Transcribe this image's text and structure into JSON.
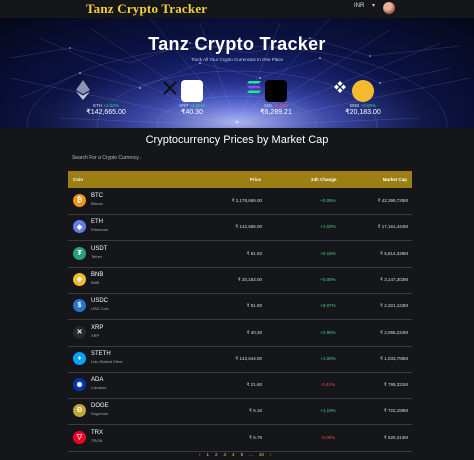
{
  "header": {
    "brand": "Tanz Crypto Tracker",
    "currency": "INR"
  },
  "banner": {
    "title": "Tanz Crypto Tracker",
    "subtitle": "Track All Your Crypto Currencies In One Place",
    "coins": [
      {
        "symbol": "ETH",
        "change": "+1.02%",
        "price": "₹142,665.00",
        "icon": "ethereum-icon"
      },
      {
        "symbol": "XRP",
        "change": "+2.95%",
        "price": "₹40.30",
        "icon": "xrp-icon"
      },
      {
        "symbol": "SOL",
        "change": "-0.40%",
        "price": "₹6,289.21",
        "icon": "solana-icon"
      },
      {
        "symbol": "BNB",
        "change": "+0.00%",
        "price": "₹20,183.00",
        "icon": "bnb-icon"
      }
    ]
  },
  "section": {
    "title": "Cryptocurrency Prices by Market Cap",
    "search_placeholder": "Search For a Crypto Currency.."
  },
  "table": {
    "headers": {
      "coin": "Coin",
      "price": "Price",
      "change": "24h Change",
      "mcap": "Market Cap"
    },
    "rows": [
      {
        "symbol": "BTC",
        "name": "Bitcoin",
        "price": "₹ 2,178,665.00",
        "change": "+0.06%",
        "mcap": "₹ 42,399,725M",
        "dir": "pos",
        "color": "#f7931a",
        "glyph": "₿"
      },
      {
        "symbol": "ETH",
        "name": "Ethereum",
        "price": "₹ 142,665.00",
        "change": "+1.02%",
        "mcap": "₹ 17,161,444M",
        "dir": "pos",
        "color": "#627eea",
        "glyph": "◆"
      },
      {
        "symbol": "USDT",
        "name": "Tether",
        "price": "₹ 81.92",
        "change": "+0.15%",
        "mcap": "₹ 5,814,329M",
        "dir": "pos",
        "color": "#26a17b",
        "glyph": "₮"
      },
      {
        "symbol": "BNB",
        "name": "BNB",
        "price": "₹ 20,183.00",
        "change": "+0.00%",
        "mcap": "₹ 3,147,303M",
        "dir": "pos",
        "color": "#f3ba2f",
        "glyph": "◈"
      },
      {
        "symbol": "USDC",
        "name": "USD Coin",
        "price": "₹ 81.90",
        "change": "+0.07%",
        "mcap": "₹ 2,321,123M",
        "dir": "pos",
        "color": "#2775ca",
        "glyph": "$"
      },
      {
        "symbol": "XRP",
        "name": "XRP",
        "price": "₹ 40.30",
        "change": "+2.95%",
        "mcap": "₹ 2,066,224M",
        "dir": "pos",
        "color": "#23292f",
        "glyph": "✕"
      },
      {
        "symbol": "STETH",
        "name": "Lido Staked Ether",
        "price": "₹ 142,644.00",
        "change": "+1.00%",
        "mcap": "₹ 1,033,758M",
        "dir": "pos",
        "color": "#00a3ff",
        "glyph": "♦"
      },
      {
        "symbol": "ADA",
        "name": "Cardano",
        "price": "₹ 21.60",
        "change": "-0.41%",
        "mcap": "₹ 789,321M",
        "dir": "neg",
        "color": "#0033ad",
        "glyph": "✺"
      },
      {
        "symbol": "DOGE",
        "name": "Dogecoin",
        "price": "₹ 5.16",
        "change": "+1.19%",
        "mcap": "₹ 722,159M",
        "dir": "pos",
        "color": "#c2a633",
        "glyph": "Ð"
      },
      {
        "symbol": "TRX",
        "name": "TRON",
        "price": "₹ 5.79",
        "change": "-0.00%",
        "mcap": "₹ 520,313M",
        "dir": "neg",
        "color": "#ef0027",
        "glyph": "▽"
      }
    ]
  },
  "pagination": [
    "‹",
    "1",
    "2",
    "3",
    "4",
    "5",
    "...",
    "10",
    "›"
  ]
}
